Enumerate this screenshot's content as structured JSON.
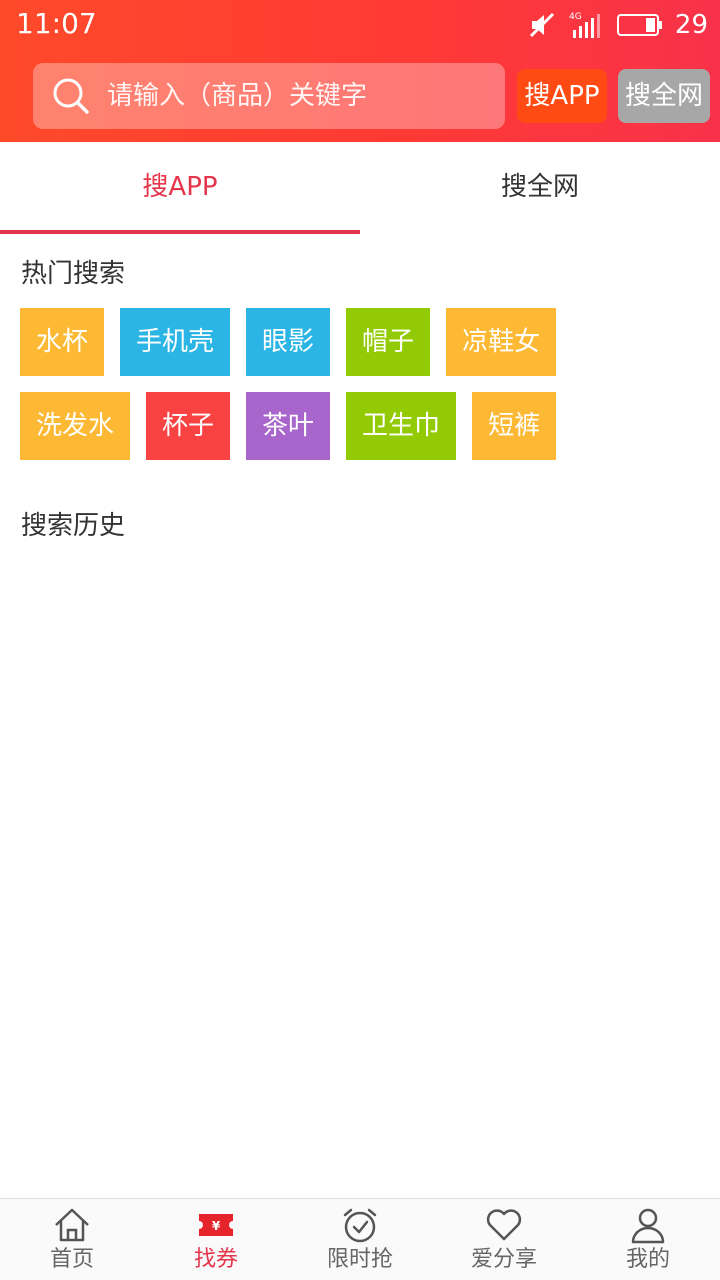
{
  "status_bar": {
    "time": "11:07",
    "battery_level": "29"
  },
  "search": {
    "placeholder": "请输入（商品）关键字",
    "btn_app": "搜APP",
    "btn_web": "搜全网"
  },
  "tabs": [
    {
      "label": "搜APP",
      "active": true
    },
    {
      "label": "搜全网",
      "active": false
    }
  ],
  "hot_search": {
    "title": "热门搜索",
    "row1": [
      {
        "label": "水杯",
        "color": "#fdb933"
      },
      {
        "label": "手机壳",
        "color": "#2bb5e4"
      },
      {
        "label": "眼影",
        "color": "#2bb5e4"
      },
      {
        "label": "帽子",
        "color": "#92cb05"
      },
      {
        "label": "凉鞋女",
        "color": "#fdb933"
      }
    ],
    "row2": [
      {
        "label": "洗发水",
        "color": "#fdb933"
      },
      {
        "label": "杯子",
        "color": "#f94343"
      },
      {
        "label": "茶叶",
        "color": "#a865cc"
      },
      {
        "label": "卫生巾",
        "color": "#92cb05"
      },
      {
        "label": "短裤",
        "color": "#fdb933"
      }
    ]
  },
  "history": {
    "title": "搜索历史"
  },
  "bottom_nav": [
    {
      "label": "首页",
      "icon": "home-icon"
    },
    {
      "label": "找券",
      "icon": "coupon-icon"
    },
    {
      "label": "限时抢",
      "icon": "alarm-clock-icon"
    },
    {
      "label": "爱分享",
      "icon": "heart-icon"
    },
    {
      "label": "我的",
      "icon": "user-icon"
    }
  ],
  "colors": {
    "accent": "#e5354a",
    "header_start": "#ff4a2a",
    "header_end": "#f8324a",
    "btn_app": "#ff4a14",
    "btn_web": "#a7a7a7"
  }
}
